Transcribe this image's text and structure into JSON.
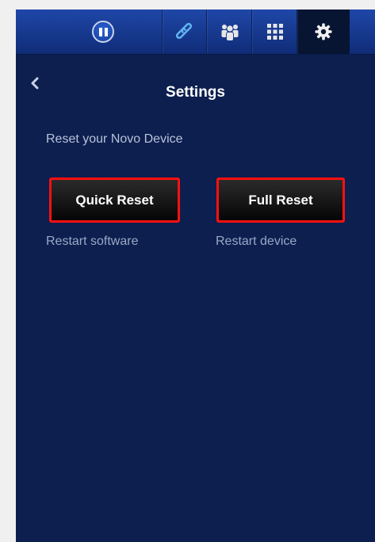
{
  "toolbar": {
    "tabs": [
      {
        "id": "play-pause",
        "icon": "pause-icon"
      },
      {
        "id": "link",
        "icon": "link-icon"
      },
      {
        "id": "users",
        "icon": "users-icon"
      },
      {
        "id": "apps",
        "icon": "grid-icon"
      },
      {
        "id": "settings",
        "icon": "gear-icon",
        "active": true
      }
    ]
  },
  "header": {
    "back_icon": "chevron-left-icon",
    "title": "Settings"
  },
  "reset": {
    "section_label": "Reset your Novo Device",
    "quick": {
      "label": "Quick Reset",
      "description": "Restart software"
    },
    "full": {
      "label": "Full Reset",
      "description": "Restart device"
    }
  },
  "colors": {
    "background": "#0c1f4f",
    "toolbar": "#1f47a8",
    "active_tab": "#071532",
    "button": "#111111",
    "highlight_border": "#ff1010",
    "link_icon": "#5fb2f0"
  }
}
